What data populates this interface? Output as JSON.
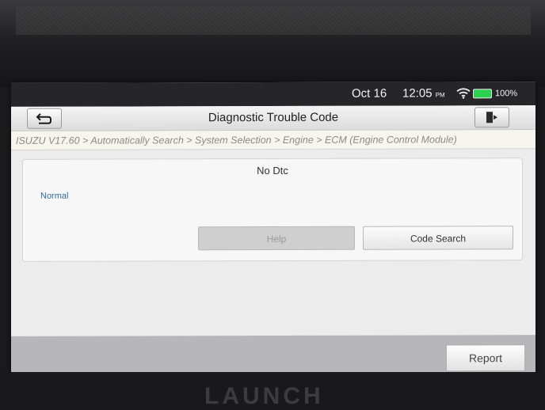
{
  "device": {
    "brand": "LAUNCH"
  },
  "status_bar": {
    "date": "Oct 16",
    "time": "12:05",
    "ampm": "PM",
    "battery": "100%",
    "wifi_icon": "wifi-icon",
    "battery_icon": "battery-full-icon",
    "battery_color": "#2bd14f"
  },
  "header": {
    "title": "Diagnostic Trouble Code",
    "back_icon": "back-arrow-icon",
    "exit_icon": "exit-icon"
  },
  "breadcrumb": "ISUZU V17.60 > Automatically Search > System Selection > Engine > ECM (Engine Control Module)",
  "result": {
    "header": "No Dtc",
    "status": "Normal",
    "help_label": "Help",
    "code_search_label": "Code Search"
  },
  "footer": {
    "report_label": "Report"
  }
}
